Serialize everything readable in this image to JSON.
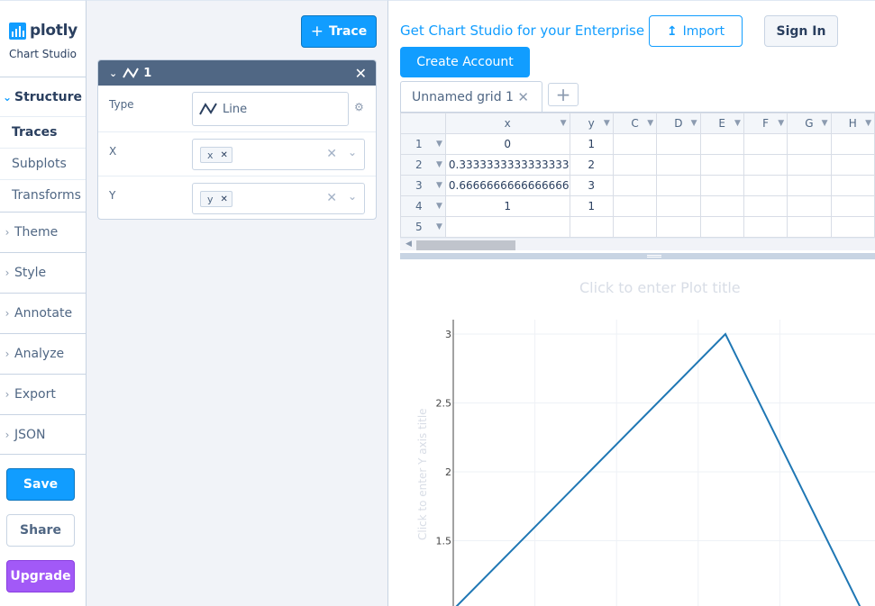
{
  "sidebar": {
    "logo_text": "plotly",
    "logo_sub": "Chart Studio",
    "structure": "Structure",
    "sub_items": [
      "Traces",
      "Subplots",
      "Transforms"
    ],
    "sections": [
      "Theme",
      "Style",
      "Annotate",
      "Analyze",
      "Export",
      "JSON"
    ],
    "save": "Save",
    "share": "Share",
    "upgrade": "Upgrade"
  },
  "panel": {
    "add_trace": "Trace",
    "trace_title": "1",
    "type_label": "Type",
    "type_value": "Line",
    "x_label": "X",
    "x_chip": "x",
    "y_label": "Y",
    "y_chip": "y"
  },
  "topbar": {
    "promo": "Get Chart Studio for your Enterprise",
    "import": "Import",
    "sign_in": "Sign In",
    "create_account": "Create Account"
  },
  "grid": {
    "tab": "Unnamed grid 1",
    "columns": [
      "x",
      "y",
      "C",
      "D",
      "E",
      "F",
      "G",
      "H"
    ],
    "rows": [
      {
        "n": "1",
        "x": "0",
        "y": "1"
      },
      {
        "n": "2",
        "x": "0.3333333333333333",
        "y": "2"
      },
      {
        "n": "3",
        "x": "0.6666666666666666",
        "y": "3"
      },
      {
        "n": "4",
        "x": "1",
        "y": "1"
      },
      {
        "n": "5",
        "x": "",
        "y": ""
      }
    ]
  },
  "chart_data": {
    "type": "line",
    "title": "Click to enter Plot title",
    "ylabel": "Click to enter Y axis title",
    "x": [
      0,
      0.3333333333333333,
      0.6666666666666666,
      1
    ],
    "y": [
      1,
      2,
      3,
      1
    ],
    "xlim": [
      0,
      1
    ],
    "ylim": [
      1,
      3.1
    ],
    "yticks": [
      "1.5",
      "2",
      "2.5",
      "3"
    ],
    "line_color": "#1f77b4",
    "grid": true
  }
}
